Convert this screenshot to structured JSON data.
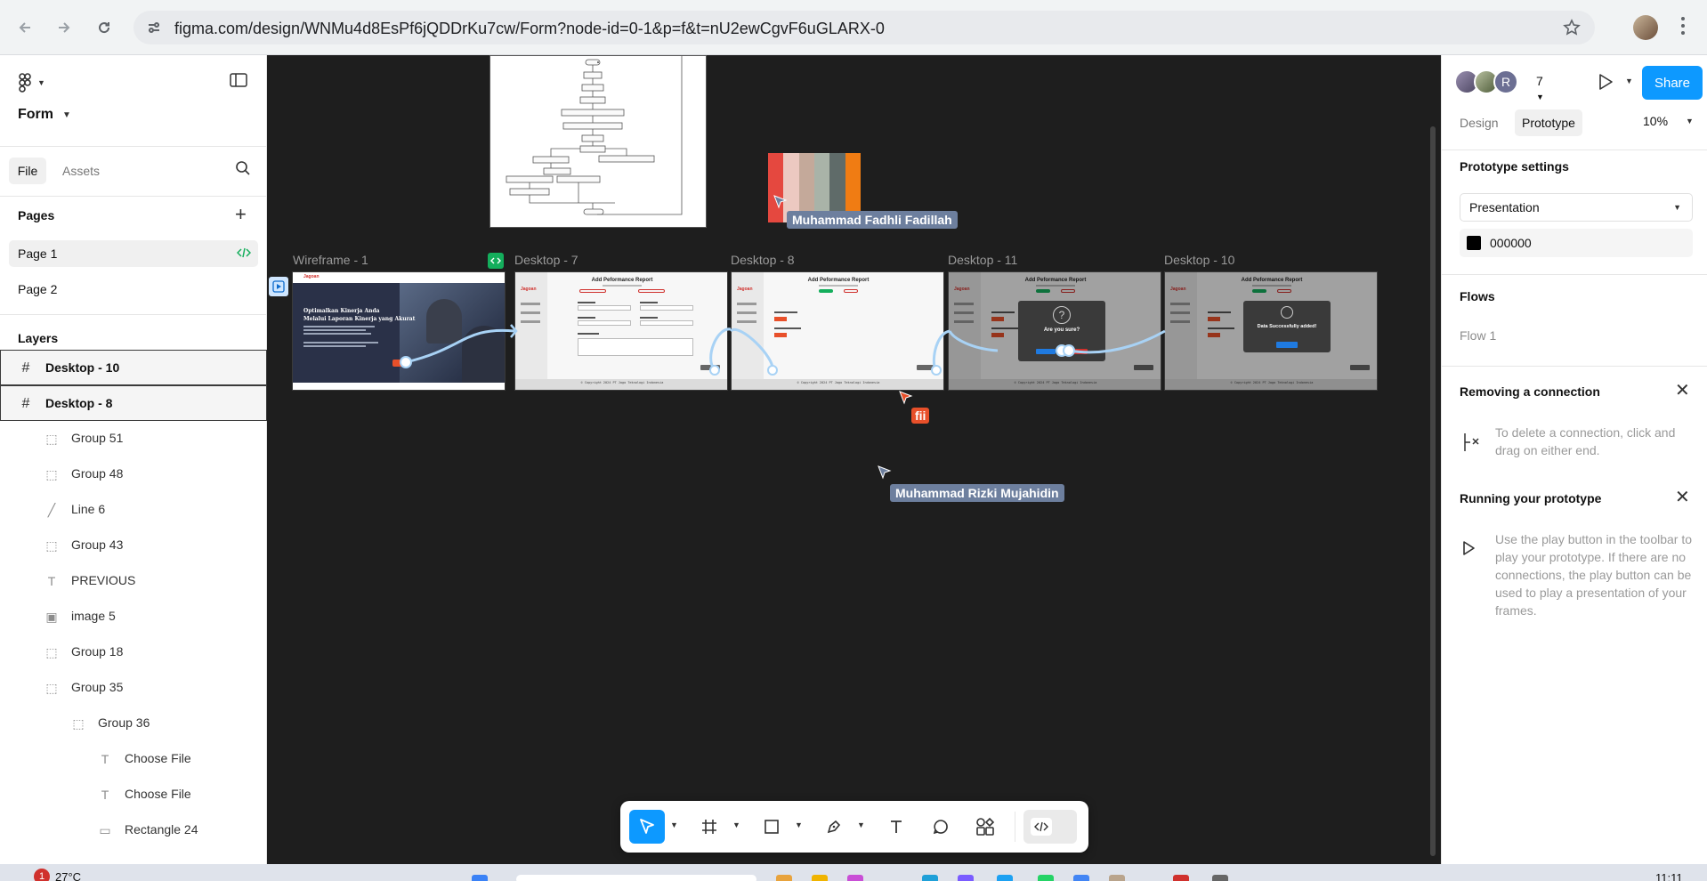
{
  "browser": {
    "url": "figma.com/design/WNMu4d8EsPf6jQDDrKu7cw/Form?node-id=0-1&p=f&t=nU2ewCgvF6uGLARX-0"
  },
  "left_panel": {
    "file_name": "Form",
    "tabs": {
      "file": "File",
      "assets": "Assets"
    },
    "pages_title": "Pages",
    "pages": [
      "Page 1",
      "Page 2"
    ],
    "active_page": "Page 1",
    "layers_title": "Layers",
    "layers": [
      {
        "name": "Desktop - 10",
        "icon": "frame-icon",
        "depth": 0
      },
      {
        "name": "Desktop - 8",
        "icon": "frame-icon",
        "depth": 0
      },
      {
        "name": "Group 51",
        "icon": "group-icon",
        "depth": 1
      },
      {
        "name": "Group 48",
        "icon": "group-icon",
        "depth": 1
      },
      {
        "name": "Line 6",
        "icon": "line-icon",
        "depth": 1
      },
      {
        "name": "Group 43",
        "icon": "group-icon",
        "depth": 1
      },
      {
        "name": "PREVIOUS",
        "icon": "text-icon",
        "depth": 1
      },
      {
        "name": "image 5",
        "icon": "image-icon",
        "depth": 1
      },
      {
        "name": "Group 18",
        "icon": "group-icon",
        "depth": 1
      },
      {
        "name": "Group 35",
        "icon": "group-icon",
        "depth": 1
      },
      {
        "name": "Group 36",
        "icon": "group-icon",
        "depth": 2
      },
      {
        "name": "Choose File",
        "icon": "text-icon",
        "depth": 3
      },
      {
        "name": "Choose File",
        "icon": "text-icon",
        "depth": 3
      },
      {
        "name": "Rectangle 24",
        "icon": "rectangle-icon",
        "depth": 3
      }
    ]
  },
  "canvas": {
    "frames": [
      {
        "label": "Wireframe - 1"
      },
      {
        "label": "Desktop - 7"
      },
      {
        "label": "Desktop - 8"
      },
      {
        "label": "Desktop - 11"
      },
      {
        "label": "Desktop - 10"
      }
    ],
    "frame_content": {
      "report_title": "Add Peformance Report",
      "brand": "Jagoan",
      "hero_title_1": "Optimalkan Kinerja Anda",
      "hero_title_2": "Melalui Laporan Kinerja yang Akurat",
      "dialog_confirm": "Are you sure?",
      "dialog_success": "Data Successfully added!",
      "copyright": "© Copyright 2024 PT Jago Teknologi Indonesia"
    },
    "cursors": [
      {
        "name": "Muhammad Fadhli Fadillah",
        "color": "#6d7f9e"
      },
      {
        "name": "fii",
        "color": "#e8502a"
      },
      {
        "name": "Muhammad Rizki Mujahidin",
        "color": "#6d7f9e"
      }
    ],
    "palette": [
      "#e5483f",
      "#ecc9c1",
      "#c4a99a",
      "#a9b3a8",
      "#5f6b69",
      "#f07c13"
    ]
  },
  "toolbar": {
    "tools": [
      "move-tool",
      "frame-tool",
      "shape-tool",
      "pen-tool",
      "text-tool",
      "comment-tool",
      "actions-tool",
      "dev-mode-toggle"
    ]
  },
  "right_panel": {
    "avatar_initial": "R",
    "collaborator_count": "7",
    "share_label": "Share",
    "tabs": {
      "design": "Design",
      "prototype": "Prototype"
    },
    "zoom": "10%",
    "prototype_settings_title": "Prototype settings",
    "device": "Presentation",
    "background_color": "000000",
    "flows_title": "Flows",
    "flow_name": "Flow 1",
    "removing_title": "Removing a connection",
    "removing_text": "To delete a connection, click and drag on either end.",
    "running_title": "Running your prototype",
    "running_text": "Use the play button in the toolbar to play your prototype. If there are no connections, the play button can be used to play a presentation of your frames."
  },
  "taskbar": {
    "weather_badge": "1",
    "weather": "27°C",
    "time": "11:11"
  },
  "colors": {
    "accent": "#0d99ff",
    "canvas_bg": "#1e1e1e",
    "connection": "#a8d2f5"
  }
}
